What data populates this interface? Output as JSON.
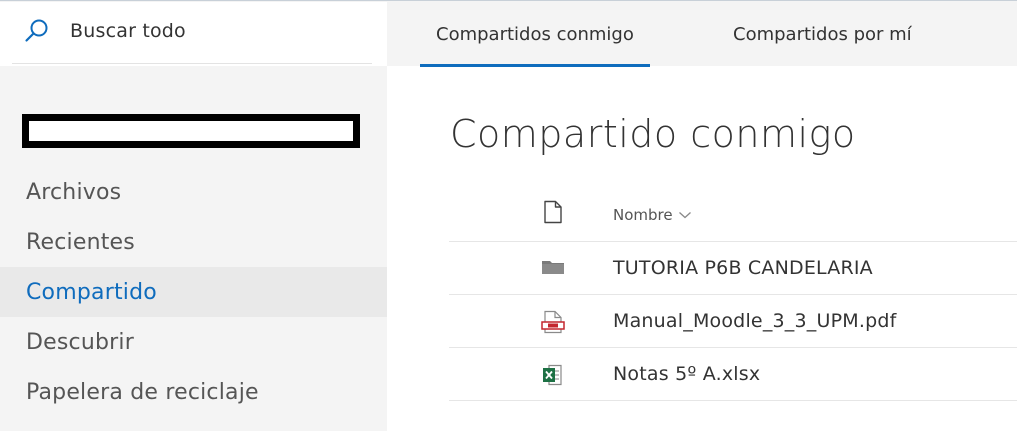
{
  "sidebar": {
    "search_label": "Buscar todo",
    "items": [
      {
        "label": "Archivos",
        "active": false
      },
      {
        "label": "Recientes",
        "active": false
      },
      {
        "label": "Compartido",
        "active": true
      },
      {
        "label": "Descubrir",
        "active": false
      },
      {
        "label": "Papelera de reciclaje",
        "active": false
      }
    ]
  },
  "main": {
    "tabs": [
      {
        "label": "Compartidos conmigo",
        "active": true
      },
      {
        "label": "Compartidos por mí",
        "active": false
      }
    ],
    "title": "Compartido conmigo",
    "list": {
      "column_name": "Nombre",
      "rows": [
        {
          "name": "TUTORIA P6B CANDELARIA",
          "icon": "folder-icon"
        },
        {
          "name": "Manual_Moodle_3_3_UPM.pdf",
          "icon": "pdf-file-icon"
        },
        {
          "name": "Notas 5º A.xlsx",
          "icon": "excel-file-icon"
        }
      ]
    }
  },
  "colors": {
    "accent": "#0f6cbd",
    "sidebar_bg": "#f4f4f4",
    "active_bg": "#e9e9e9",
    "pdf_red": "#c4262e",
    "excel_green": "#1e7145"
  }
}
